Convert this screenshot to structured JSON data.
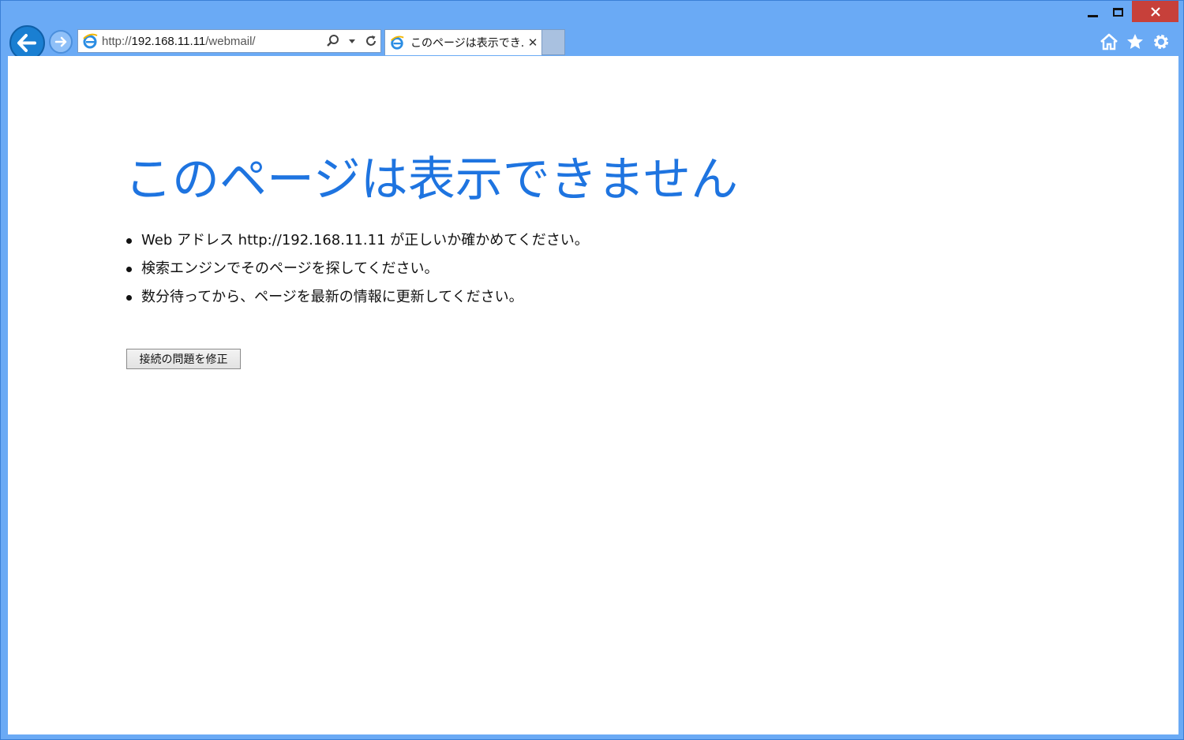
{
  "browser": {
    "address": {
      "scheme": "http://",
      "host": "192.168.11.11",
      "path": "/webmail/"
    },
    "tab": {
      "title": "このページは表示でき...",
      "close_glyph": "✕"
    },
    "colors": {
      "frame": "#6aaaf5",
      "close_button": "#c7403a",
      "back_button": "#1a7fd2"
    },
    "icons": [
      "back-icon",
      "forward-icon",
      "ie-logo-icon",
      "search-icon",
      "dropdown-icon",
      "refresh-icon",
      "home-icon",
      "star-icon",
      "gear-icon"
    ]
  },
  "page": {
    "title": "このページは表示できません",
    "suggestions": [
      "Web アドレス http://192.168.11.11 が正しいか確かめてください。",
      "検索エンジンでそのページを探してください。",
      "数分待ってから、ページを最新の情報に更新してください。"
    ],
    "fix_button_label": "接続の問題を修正",
    "title_color": "#1e74e0"
  }
}
